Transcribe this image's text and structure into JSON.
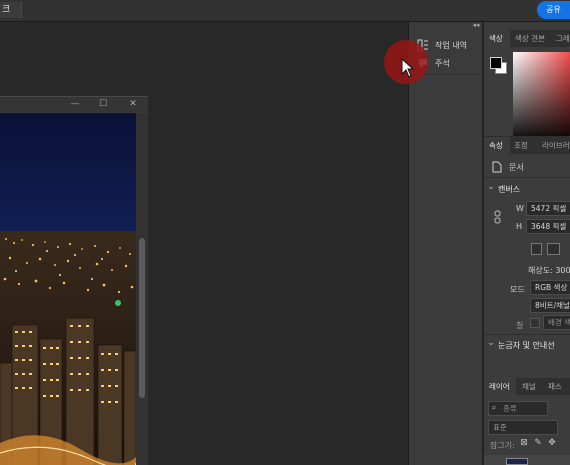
{
  "topbar": {
    "doc_tab_label": "크",
    "share_label": "공유"
  },
  "dock": {
    "collapse_glyph": "◂◂",
    "items": [
      {
        "label": "작업 내역",
        "icon": "history-icon"
      },
      {
        "label": "주석",
        "icon": "notes-icon"
      }
    ]
  },
  "document_window": {
    "minimize_glyph": "—",
    "maximize_glyph": "☐",
    "close_glyph": "✕"
  },
  "color_panel": {
    "tabs": [
      "색상",
      "색상 견본",
      "그레"
    ],
    "active_tab": "색상",
    "foreground_color": "#000000",
    "background_color": "#ffffff",
    "hue_color": "#f24a4a"
  },
  "properties_panel": {
    "tabs": [
      "속성",
      "조정",
      "라이브러"
    ],
    "active_tab": "속성",
    "doc_type_label": "문서",
    "canvas_section": "캔버스",
    "width_label": "W",
    "width_value": "5472 픽셀",
    "height_label": "H",
    "height_value": "3648 픽셀",
    "resolution_label": "해상도: 300",
    "mode_label": "모드",
    "mode_value": "RGB 색상",
    "bit_value": "8비트/채널",
    "fill_label": "칠",
    "fill_value": "배경 색",
    "rulers_section": "눈금자 및 안내선"
  },
  "layers_panel": {
    "tabs": [
      "레이어",
      "채널",
      "패스"
    ],
    "active_tab": "레이어",
    "search_placeholder": "종류",
    "blend_mode": "표준",
    "lock_label": "잠그기:"
  },
  "colors": {
    "accent": "#1473e6",
    "cursor_highlight": "#961616"
  }
}
